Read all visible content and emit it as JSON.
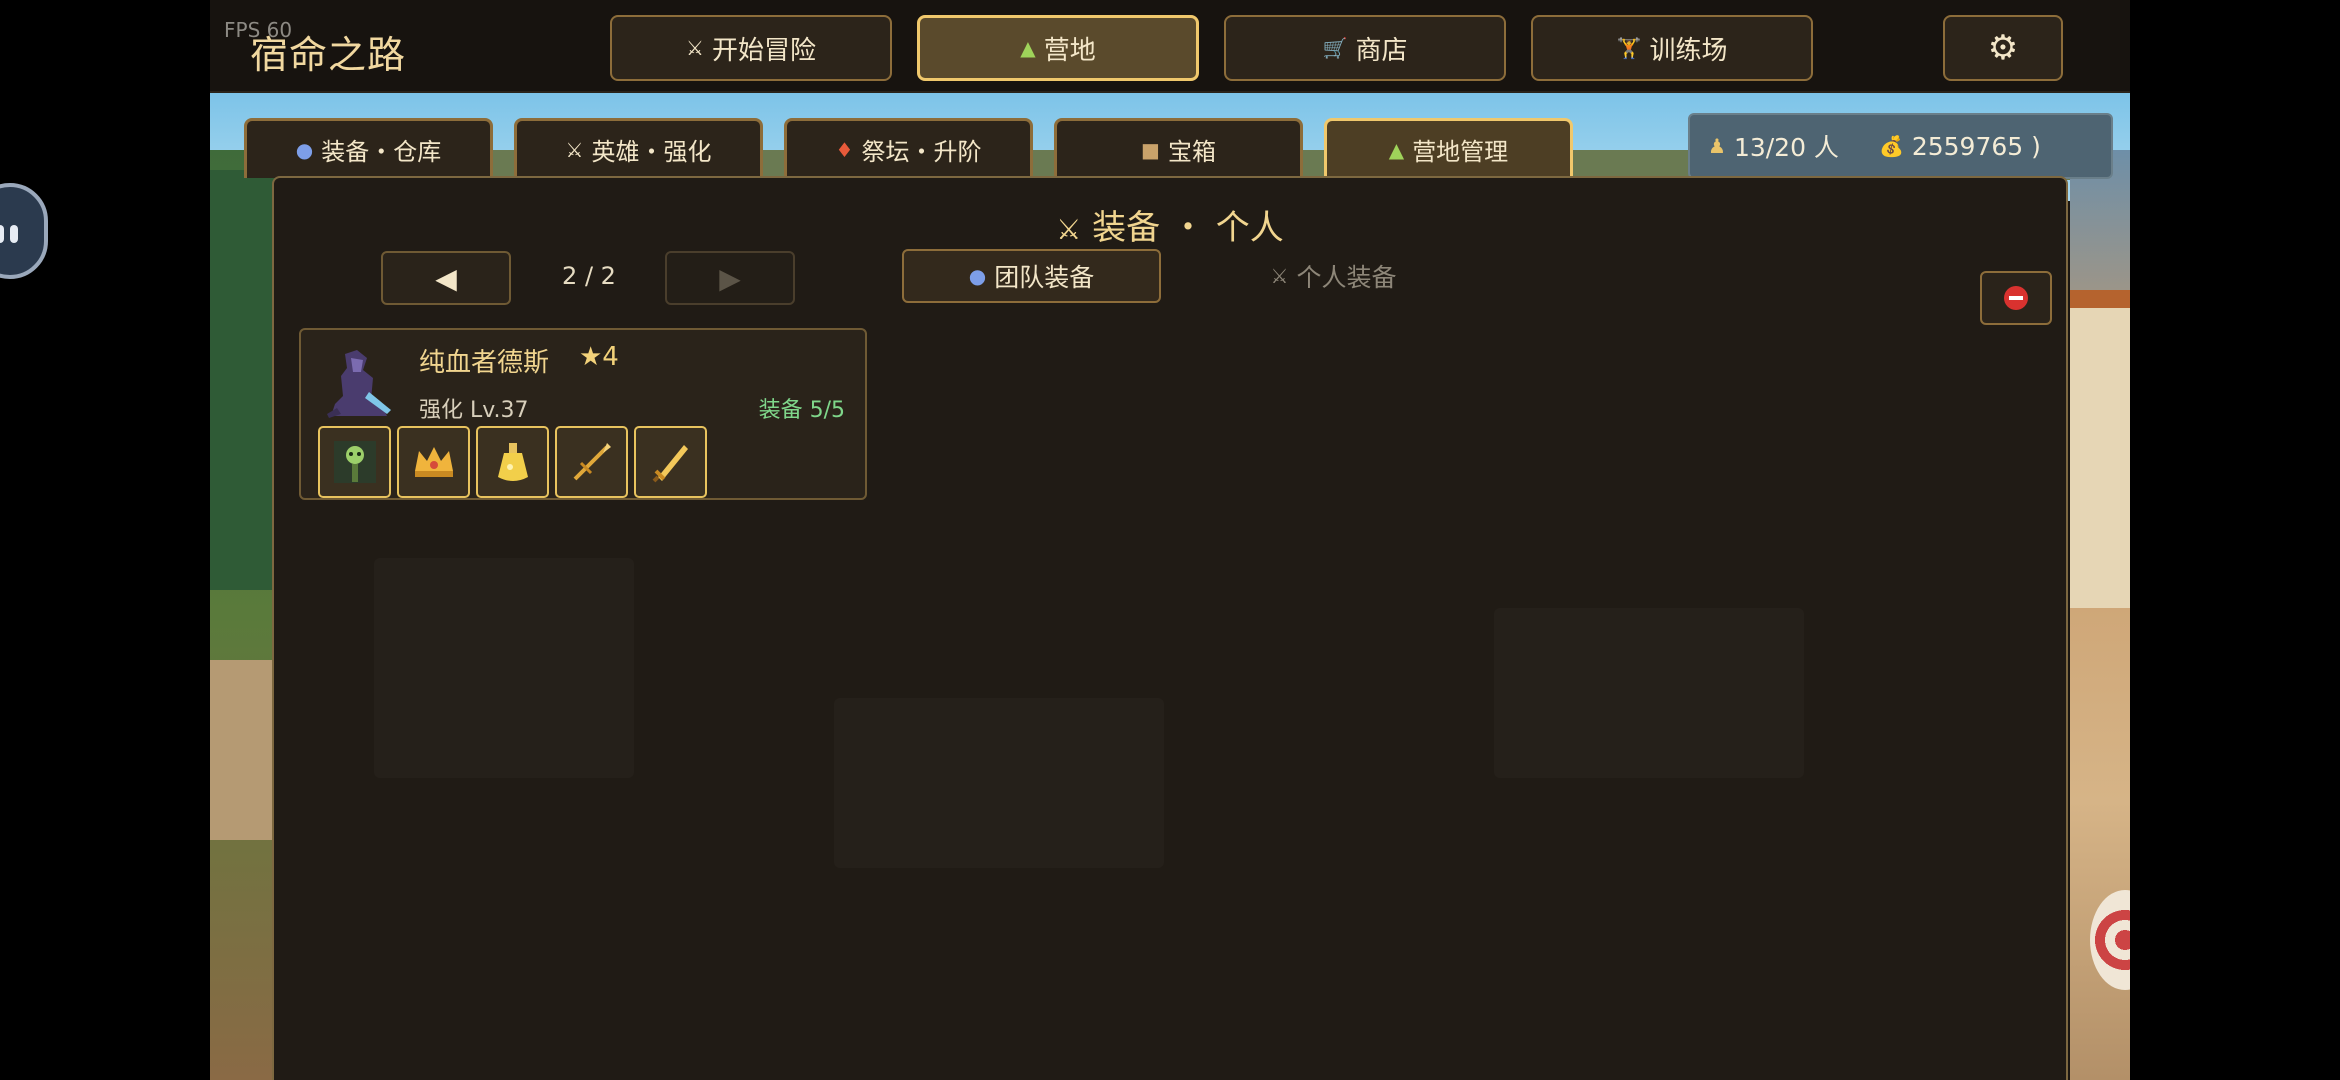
{
  "top_bar": {
    "fps": "FPS 60",
    "title": "宿命之路",
    "nav": [
      {
        "label": "开始冒险",
        "icon": "crossed-swords-icon"
      },
      {
        "label": "营地",
        "icon": "campfire-icon"
      },
      {
        "label": "商店",
        "icon": "shop-cart-icon"
      },
      {
        "label": "训练场",
        "icon": "training-icon"
      }
    ],
    "settings_icon": "gear-icon"
  },
  "tabs": [
    {
      "label": "装备・仓库",
      "icon": "bag-icon"
    },
    {
      "label": "英雄・强化",
      "icon": "crossed-swords-icon"
    },
    {
      "label": "祭坛・升阶",
      "icon": "altar-icon"
    },
    {
      "label": "宝箱",
      "icon": "chest-icon"
    },
    {
      "label": "营地管理",
      "icon": "campfire-icon"
    }
  ],
  "resources": {
    "population": "13/20 人",
    "gold": "2559765 )"
  },
  "panel": {
    "title": "装备 ・ 个人",
    "prev_label": "◀",
    "next_label": "▶",
    "page": "2 / 2",
    "team_equipment": "团队装备",
    "personal_equipment": "个人装备"
  },
  "hero": {
    "name": "纯血者德斯",
    "stars": "★4",
    "level": "强化 Lv.37",
    "equipment": "装备 5/5",
    "slots": [
      "skull-staff-icon",
      "crown-icon",
      "potion-icon",
      "spear-icon",
      "sword-icon"
    ]
  },
  "colors": {
    "accent_gold": "#f0c86c",
    "panel_bg": "#201b15",
    "equip_green": "#7fd68a"
  }
}
